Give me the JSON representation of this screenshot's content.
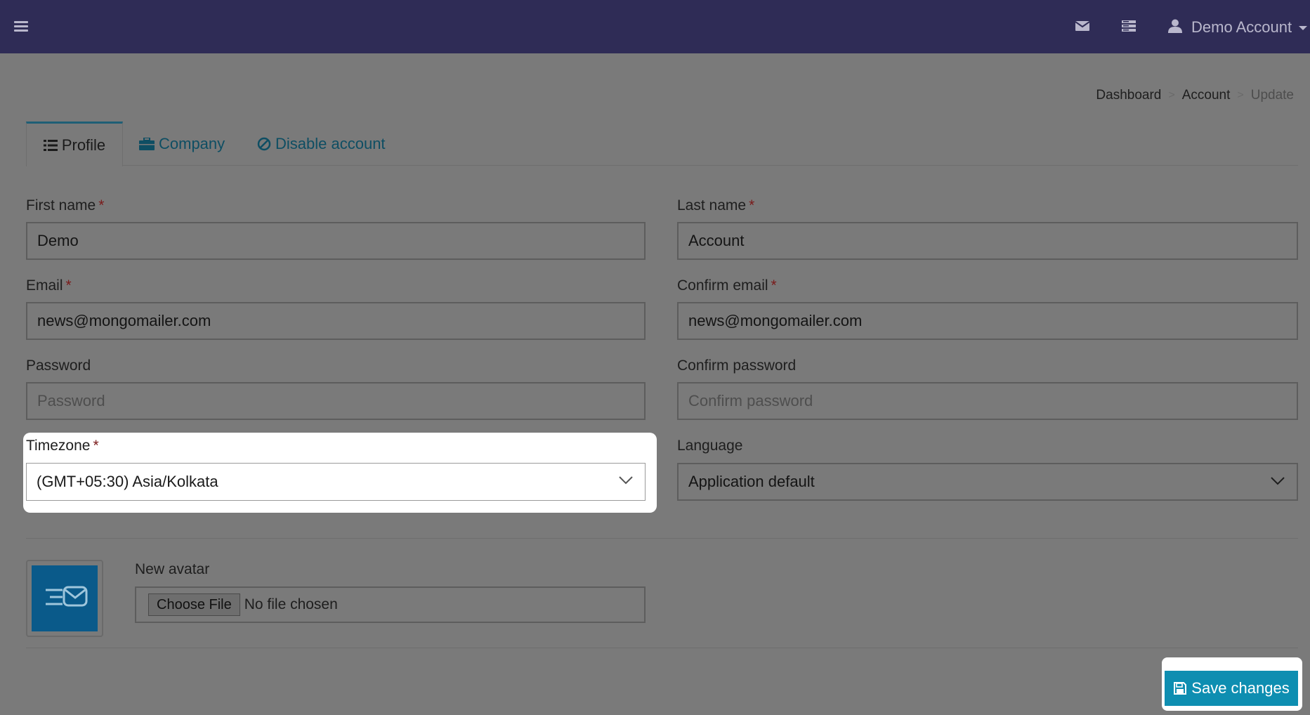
{
  "header": {
    "menu_icon": "hamburger-icon",
    "mail_icon": "envelope-icon",
    "server_icon": "server-icon",
    "user_icon": "user-icon",
    "user_name": "Demo Account"
  },
  "breadcrumb": {
    "items": [
      "Dashboard",
      "Account"
    ],
    "separator": ">",
    "current": "Update"
  },
  "tabs": [
    {
      "label": "Profile",
      "icon": "list-icon",
      "active": true
    },
    {
      "label": "Company",
      "icon": "briefcase-icon",
      "active": false
    },
    {
      "label": "Disable account",
      "icon": "ban-icon",
      "active": false
    }
  ],
  "form": {
    "required_mark": "*",
    "first_name": {
      "label": "First name",
      "value": "Demo",
      "required": true
    },
    "last_name": {
      "label": "Last name",
      "value": "Account",
      "required": true
    },
    "email": {
      "label": "Email",
      "value": "news@mongomailer.com",
      "required": true
    },
    "confirm_email": {
      "label": "Confirm email",
      "value": "news@mongomailer.com",
      "required": true
    },
    "password": {
      "label": "Password",
      "placeholder": "Password",
      "value": ""
    },
    "confirm_password": {
      "label": "Confirm password",
      "placeholder": "Confirm password",
      "value": ""
    },
    "timezone": {
      "label": "Timezone",
      "value": "(GMT+05:30) Asia/Kolkata",
      "required": true
    },
    "language": {
      "label": "Language",
      "value": "Application default"
    },
    "avatar": {
      "label": "New avatar",
      "button": "Choose File",
      "status": "No file chosen"
    }
  },
  "actions": {
    "save_label": "Save changes",
    "save_icon": "floppy-disk-icon"
  },
  "colors": {
    "topbar": "#2f2c56",
    "overlay_background": "#7a7a7a",
    "tab_link": "#0e4e63",
    "save_button": "#0e8eb1",
    "avatar_bg": "#0a5a8a"
  }
}
